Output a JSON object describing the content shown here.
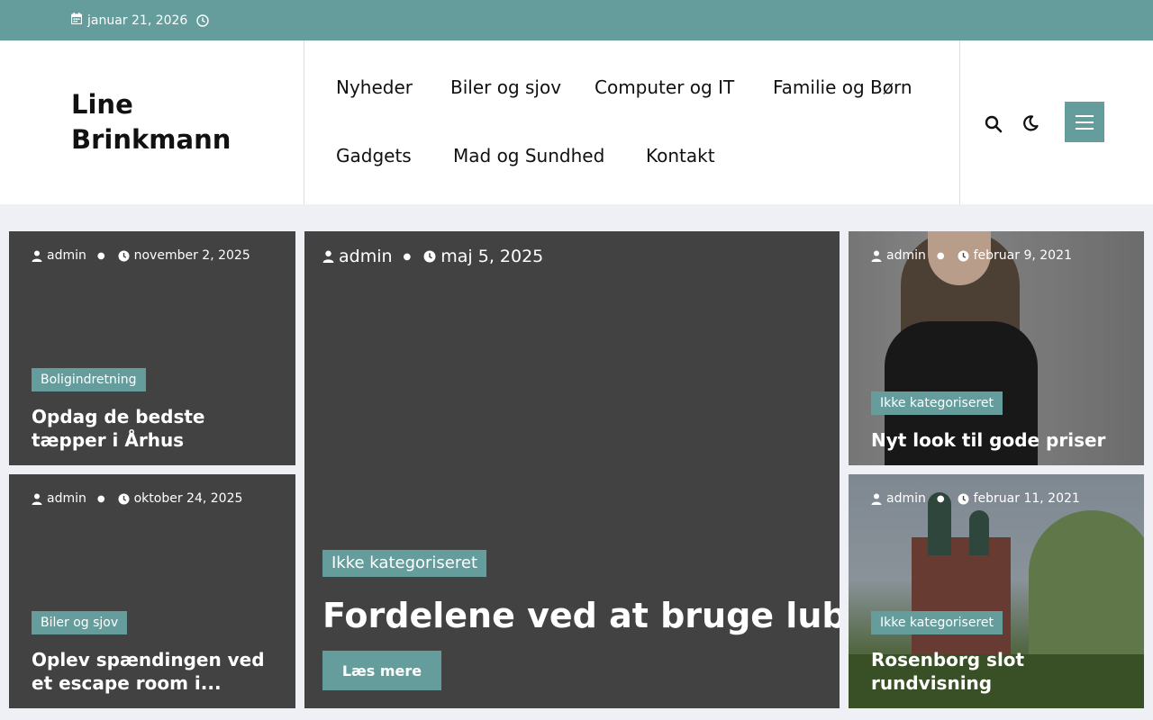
{
  "topbar": {
    "date": "januar 21, 2026"
  },
  "site": {
    "title": "Line Brinkmann"
  },
  "nav": [
    {
      "label": "Nyheder"
    },
    {
      "label": "Biler og sjov"
    },
    {
      "label": "Computer og IT"
    },
    {
      "label": "Familie og Børn"
    },
    {
      "label": "Gadgets"
    },
    {
      "label": "Mad og Sundhed"
    },
    {
      "label": "Kontakt"
    }
  ],
  "posts": [
    {
      "author": "admin",
      "date": "november 2, 2025",
      "category": "Boligindretning",
      "title": "Opdag de bedste tæpper i Århus"
    },
    {
      "author": "admin",
      "date": "oktober 24, 2025",
      "category": "Biler og sjov",
      "title": "Oplev spændingen ved et escape room i..."
    },
    {
      "author": "admin",
      "date": "maj 5, 2025",
      "category": "Ikke kategoriseret",
      "title": "Fordelene ved at bruge lube",
      "button": "Læs mere"
    },
    {
      "author": "admin",
      "date": "februar 9, 2021",
      "category": "Ikke kategoriseret",
      "title": "Nyt look til gode priser"
    },
    {
      "author": "admin",
      "date": "februar 11, 2021",
      "category": "Ikke kategoriseret",
      "title": "Rosenborg slot rundvisning"
    }
  ],
  "colors": {
    "accent": "#649d9c",
    "card": "#424242",
    "background": "#eef0f5"
  }
}
